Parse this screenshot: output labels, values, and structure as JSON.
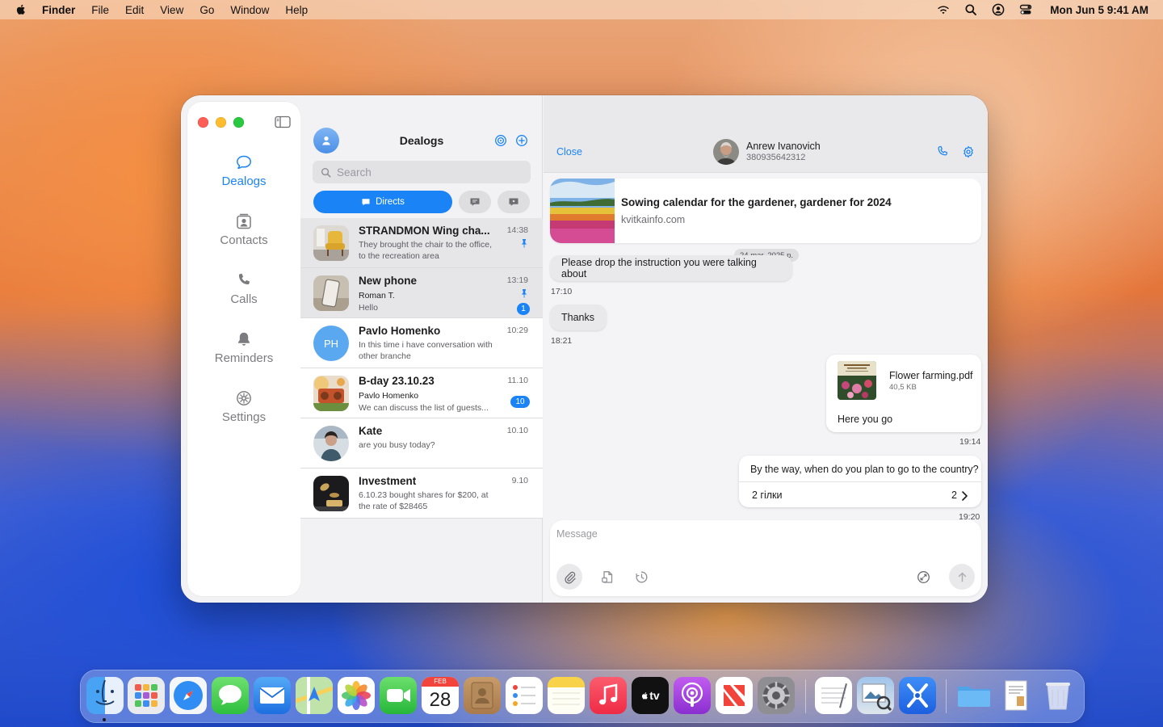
{
  "menubar": {
    "app": "Finder",
    "items": [
      "File",
      "Edit",
      "View",
      "Go",
      "Window",
      "Help"
    ],
    "clock": "Mon Jun 5  9:41 AM",
    "status_icons": [
      "wifi-icon",
      "spotlight-icon",
      "user-icon",
      "control-center-icon"
    ]
  },
  "sidebar": {
    "items": [
      {
        "label": "Dealogs",
        "icon": "chat-bubble-icon",
        "active": true
      },
      {
        "label": "Contacts",
        "icon": "contacts-icon",
        "active": false
      },
      {
        "label": "Calls",
        "icon": "phone-icon",
        "active": false
      },
      {
        "label": "Reminders",
        "icon": "bell-icon",
        "active": false
      },
      {
        "label": "Settings",
        "icon": "gear-icon",
        "active": false
      }
    ]
  },
  "list": {
    "title": "Dealogs",
    "search_placeholder": "Search",
    "tab_directs": "Directs",
    "chats": [
      {
        "name": "STRANDMON Wing cha...",
        "time": "14:38",
        "preview": "They brought the chair to the office, to the recreation area",
        "pinned": true
      },
      {
        "name": "New phone",
        "time": "13:19",
        "sender": "Roman T.",
        "preview": "Hello",
        "pinned": true,
        "badge": "1"
      },
      {
        "name": "Pavlo Homenko",
        "time": "10:29",
        "initials": "PH",
        "preview": "In this time i have conversation with other branche"
      },
      {
        "name": "B-day 23.10.23",
        "time": "11.10",
        "sender": "Pavlo Homenko",
        "preview": "We can discuss the list of guests...",
        "badge": "10"
      },
      {
        "name": "Kate",
        "time": "10.10",
        "preview": "are you busy today?"
      },
      {
        "name": "Investment",
        "time": "9.10",
        "preview": "6.10.23 bought shares for $200, at the rate of $28465"
      }
    ]
  },
  "conversation": {
    "close_label": "Close",
    "contact_name": "Anrew Ivanovich",
    "contact_phone": "380935642312",
    "link_card": {
      "title": "Sowing calendar for the gardener, gardener for 2024",
      "domain": "kvitkainfo.com"
    },
    "date_pill": "24 mar. 2025 p.",
    "messages": [
      {
        "text": "Please drop the instruction you were talking about",
        "time": "17:10"
      },
      {
        "text": "Thanks",
        "time": "18:21"
      }
    ],
    "file_message": {
      "file_name": "Flower farming.pdf",
      "file_size": "40,5 KB",
      "caption": "Here you go",
      "time": "19:14"
    },
    "thread_message": {
      "text": "By the way, when do you plan to go to the country?",
      "thread_label": "2 гілки",
      "thread_count": "2",
      "time": "19:20"
    },
    "composer_placeholder": "Message"
  },
  "dock": {
    "apps": [
      "Finder",
      "Launchpad",
      "Safari",
      "Messages",
      "Mail",
      "Maps",
      "Photos",
      "FaceTime",
      "Calendar",
      "Contacts",
      "Reminders",
      "Notes",
      "Music",
      "TV",
      "Podcasts",
      "News",
      "System Settings",
      "TextEdit",
      "Preview",
      "Xcode",
      "Folder",
      "Document",
      "Trash"
    ],
    "calendar_month": "FEB",
    "calendar_day": "28",
    "tv_label": "tv"
  },
  "colors": {
    "accent": "#1a84f6",
    "badge": "#1a84f6"
  }
}
